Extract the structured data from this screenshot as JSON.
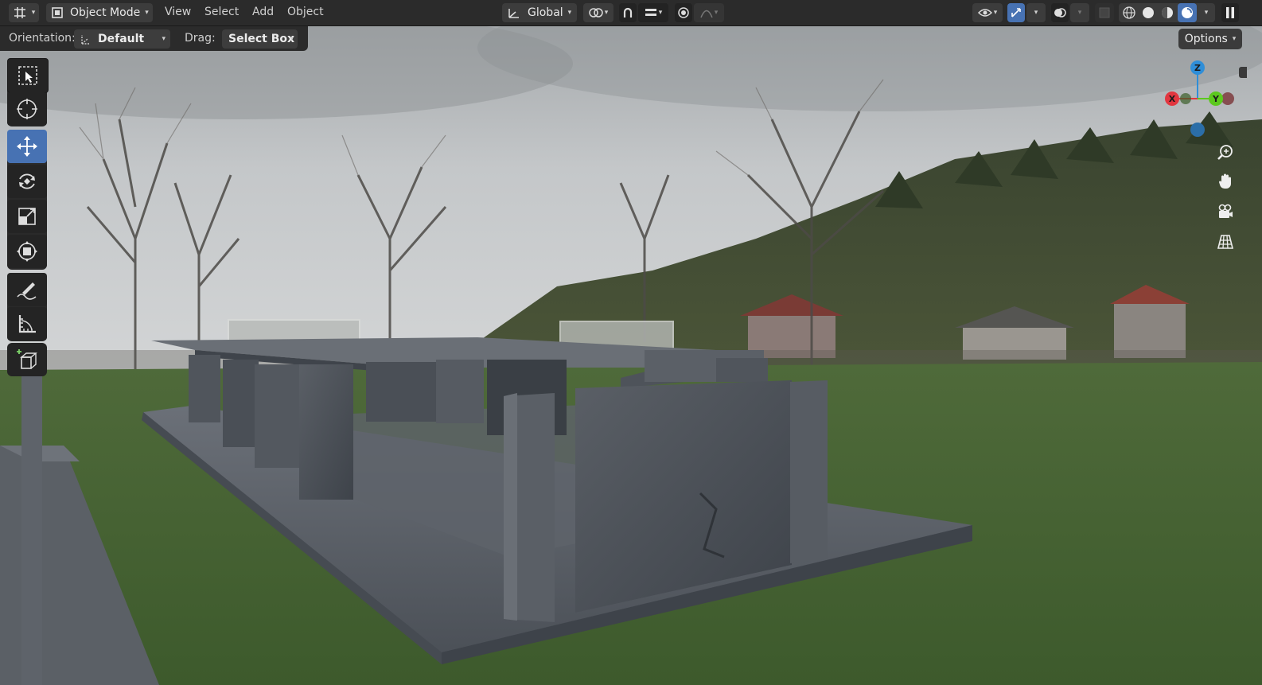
{
  "header": {
    "editor_type_icon": "editor-type-icon",
    "mode": {
      "label": "Object Mode",
      "icon": "object-mode-icon"
    },
    "menus": [
      "View",
      "Select",
      "Add",
      "Object"
    ],
    "transform_orientation": {
      "label": "Global",
      "icon": "orientation-global-icon"
    },
    "pivot_icon": "pivot-point-icon",
    "snap_icon": "snap-magnet-icon",
    "snap_target_icon": "snap-increment-icon",
    "proportional_icon": "proportional-editing-icon",
    "falloff_icon": "falloff-curve-icon",
    "visibility_icon": "visibility-eye-icon",
    "gizmo_icon": "gizmo-icon",
    "overlay_icon": "overlay-icon",
    "xray_icon": "xray-icon",
    "shading": {
      "wireframe_icon": "shading-wireframe-icon",
      "solid_icon": "shading-solid-icon",
      "material_icon": "shading-material-icon",
      "rendered_icon": "shading-rendered-icon",
      "active": "rendered"
    },
    "pause_icon": "pause-icon"
  },
  "tool_settings": {
    "orientation_label": "Orientation:",
    "orientation_value": "Default",
    "drag_label": "Drag:",
    "drag_value": "Select Box",
    "options_label": "Options"
  },
  "toolbar": {
    "tools": [
      {
        "name": "select-box-tool",
        "icon": "select-box-icon"
      },
      {
        "name": "cursor-tool",
        "icon": "cursor-icon"
      },
      {
        "name": "move-tool",
        "icon": "move-icon",
        "active": true
      },
      {
        "name": "rotate-tool",
        "icon": "rotate-icon"
      },
      {
        "name": "scale-tool",
        "icon": "scale-icon"
      },
      {
        "name": "transform-tool",
        "icon": "transform-icon"
      },
      {
        "name": "annotate-tool",
        "icon": "annotate-icon"
      },
      {
        "name": "measure-tool",
        "icon": "measure-icon"
      },
      {
        "name": "add-cube-tool",
        "icon": "add-cube-icon"
      }
    ]
  },
  "navigation_gizmo": {
    "axes": {
      "z": "Z",
      "x": "X",
      "y": "Y"
    },
    "colors": {
      "x": "#e2363f",
      "y": "#5cc81e",
      "z": "#2f8ed8"
    }
  },
  "nav_buttons": [
    "zoom-icon",
    "pan-hand-icon",
    "camera-view-icon",
    "orthographic-grid-icon"
  ],
  "colors": {
    "header_bg": "#2b2b2b",
    "button_bg": "#3c3c3c",
    "active_blue": "#4772b3"
  }
}
